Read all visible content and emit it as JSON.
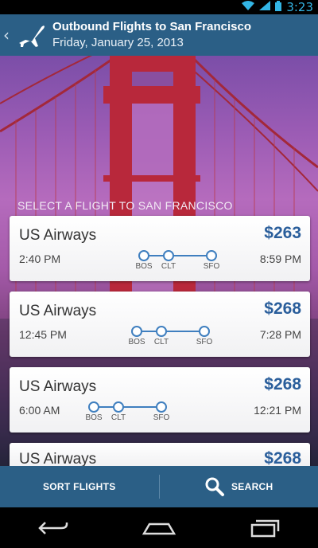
{
  "status_bar": {
    "time": "3:23"
  },
  "header": {
    "back_glyph": "‹",
    "title": "Outbound Flights to San Francisco",
    "subtitle": "Friday, January 25, 2013"
  },
  "section_label": "SELECT A FLIGHT TO SAN FRANCISCO",
  "flights": [
    {
      "airline": "US Airways",
      "price": "$263",
      "depart": "2:40 PM",
      "arrive": "8:59 PM",
      "stops": [
        "BOS",
        "CLT",
        "SFO"
      ]
    },
    {
      "airline": "US Airways",
      "price": "$268",
      "depart": "12:45 PM",
      "arrive": "7:28 PM",
      "stops": [
        "BOS",
        "CLT",
        "SFO"
      ]
    },
    {
      "airline": "US Airways",
      "price": "$268",
      "depart": "6:00 AM",
      "arrive": "12:21 PM",
      "stops": [
        "BOS",
        "CLT",
        "SFO"
      ]
    },
    {
      "airline": "US Airways",
      "price": "$268"
    }
  ],
  "bottom_bar": {
    "sort_label": "SORT FLIGHTS",
    "search_label": "SEARCH"
  },
  "icons": [
    "wifi-icon",
    "signal-icon",
    "battery-icon",
    "airplane-icon",
    "search-icon",
    "back-nav-icon",
    "home-nav-icon",
    "recents-nav-icon"
  ],
  "colors": {
    "header_bg": "#2b5f86",
    "price": "#2a5e9b",
    "route": "#3f7fbf",
    "status": "#33b5e5"
  }
}
